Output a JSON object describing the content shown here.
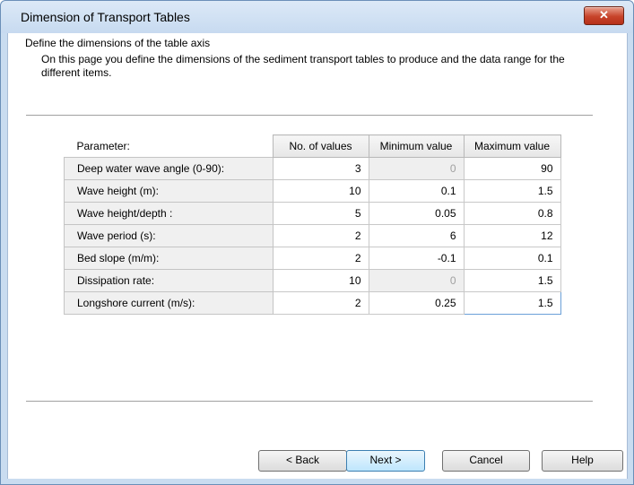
{
  "window": {
    "title": "Dimension of Transport Tables",
    "close_label": "✕"
  },
  "header": {
    "title": "Define the dimensions of the table axis",
    "description": "On this page you define the dimensions of the sediment transport tables to produce and the data range for the different items."
  },
  "table": {
    "param_header": "Parameter:",
    "columns": [
      "No. of values",
      "Minimum value",
      "Maximum value"
    ],
    "rows": [
      {
        "label": "Deep water wave angle (0-90):",
        "num": "3",
        "min": "0",
        "max": "90",
        "min_disabled": true
      },
      {
        "label": "Wave height (m):",
        "num": "10",
        "min": "0.1",
        "max": "1.5"
      },
      {
        "label": "Wave height/depth :",
        "num": "5",
        "min": "0.05",
        "max": "0.8"
      },
      {
        "label": "Wave period (s):",
        "num": "2",
        "min": "6",
        "max": "12"
      },
      {
        "label": "Bed slope (m/m):",
        "num": "2",
        "min": "-0.1",
        "max": "0.1"
      },
      {
        "label": "Dissipation rate:",
        "num": "10",
        "min": "0",
        "max": "1.5",
        "min_disabled": true
      },
      {
        "label": "Longshore current (m/s):",
        "num": "2",
        "min": "0.25",
        "max": "1.5"
      }
    ]
  },
  "buttons": {
    "back": "< Back",
    "next": "Next >",
    "cancel": "Cancel",
    "help": "Help"
  }
}
